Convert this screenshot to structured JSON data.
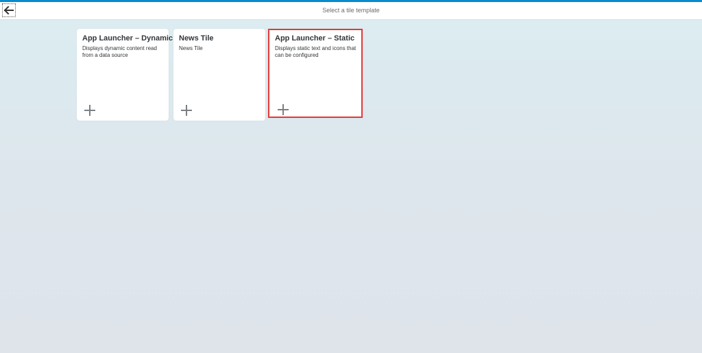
{
  "header": {
    "title": "Select a tile template",
    "back_icon": "arrow-left-icon"
  },
  "tiles": [
    {
      "title": "App Launcher – Dynamic",
      "description": "Displays dynamic content read from a data source",
      "icon": "plus-icon"
    },
    {
      "title": "News Tile",
      "description": "News Tile",
      "icon": "plus-icon"
    },
    {
      "title": "App Launcher – Static",
      "description": "Displays static text and icons that can be configured",
      "icon": "plus-icon",
      "highlight_color": "#e53935"
    }
  ],
  "colors": {
    "accent": "#0a8ad0",
    "highlight": "#e53935"
  }
}
